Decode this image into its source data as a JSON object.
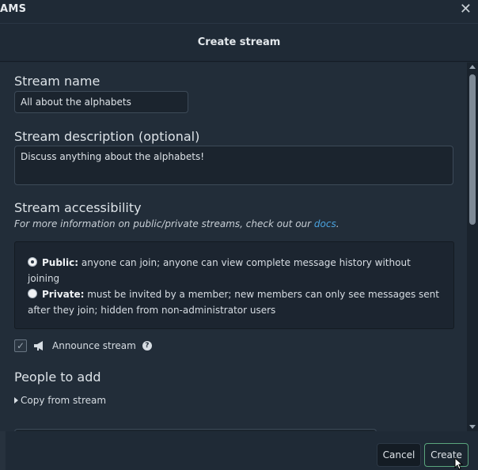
{
  "topbar": {
    "title": "AMS"
  },
  "modal": {
    "title": "Create stream",
    "stream_name": {
      "label": "Stream name",
      "value": "All about the alphabets"
    },
    "stream_description": {
      "label": "Stream description (optional)",
      "value": "Discuss anything about the alphabets!"
    },
    "accessibility": {
      "label": "Stream accessibility",
      "info_prefix": "For more information on public/private streams, check out our ",
      "info_link": "docs",
      "info_suffix": ".",
      "public_title": "Public:",
      "public_text": " anyone can join; anyone can view complete message history without joining",
      "private_title": "Private:",
      "private_text": " must be invited by a member; new members can only see messages sent after they join; hidden from non-administrator users"
    },
    "announce": {
      "label": "Announce stream",
      "help": "?"
    },
    "people": {
      "label": "People to add",
      "copy_from": "Copy from stream"
    },
    "footer": {
      "cancel": "Cancel",
      "create": "Create"
    }
  },
  "icons": {
    "close": "close-icon",
    "checkbox": "check-icon",
    "megaphone": "megaphone-icon",
    "help": "help-icon",
    "caret": "caret-right-icon"
  },
  "colors": {
    "link": "#4aa3df",
    "create_border": "#5aa57d"
  }
}
